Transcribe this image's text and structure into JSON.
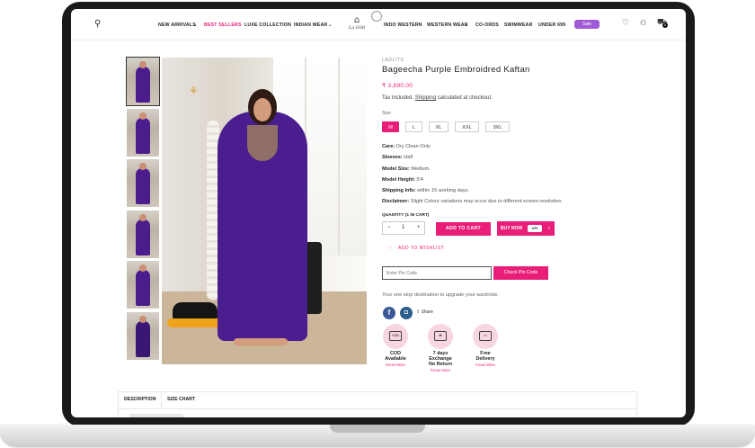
{
  "header": {
    "nav_left": [
      "NEW ARRIVALS",
      "BEST SELLERS",
      "LUXE COLLECTION",
      "INDIAN WEAR"
    ],
    "nav_right": [
      "INDO WESTERN",
      "WESTERN WEAR",
      "CO-ORDS",
      "SWIMWEAR",
      "UNDER 699"
    ],
    "logo_text": "La Gild",
    "sale_label": "Sale",
    "cart_count": "0"
  },
  "product": {
    "vendor": "LADLITS",
    "title": "Bageecha Purple Embroidred Kaftan",
    "price": "₹ 3,890.00",
    "tax_prefix": "Tax included.",
    "tax_link": "Shipping",
    "tax_suffix": "calculated at checkout.",
    "size_label": "Size",
    "sizes": [
      "M",
      "L",
      "XL",
      "XXL",
      "3XL"
    ],
    "selected_size": "M",
    "specs": [
      {
        "k": "Care:",
        "v": "Dry Clean Only"
      },
      {
        "k": "Sleeves:",
        "v": "Half"
      },
      {
        "k": "Model Size:",
        "v": "Medium"
      },
      {
        "k": "Model Height:",
        "v": "5'4"
      },
      {
        "k": "Shipping Info:",
        "v": "within 15 working days."
      },
      {
        "k": "Disclaimer:",
        "v": "Slight Colour variations may occur due to different screen resolution."
      }
    ],
    "quantity_label": "QUANTITY (1 IN CART)",
    "quantity": "1",
    "add_to_cart": "ADD TO CART",
    "buy_now": "BUY NOW",
    "pay_badge": "UPI",
    "wishlist": "ADD TO WISHLIST",
    "pin_placeholder": "Enter Pin Code",
    "check_pin": "Check Pin Code",
    "tagline": "Your one stop destination to upgrade your wardrobe.",
    "share": "Share",
    "features": [
      {
        "line1": "COD",
        "line2": "Available",
        "link": "Know More",
        "icon": "cod-icon"
      },
      {
        "line1": "7 days Exchange",
        "line2": "No Return",
        "link": "Know More",
        "icon": "exchange-icon"
      },
      {
        "line1": "Free",
        "line2": "Delivery",
        "link": "Know More",
        "icon": "delivery-truck-icon"
      }
    ]
  },
  "tabs": [
    "DESCRIPTION",
    "SIZE CHART"
  ],
  "colors": {
    "accent": "#e91e79",
    "sale": "#a05ad8",
    "dress": "#4a1e8f"
  }
}
